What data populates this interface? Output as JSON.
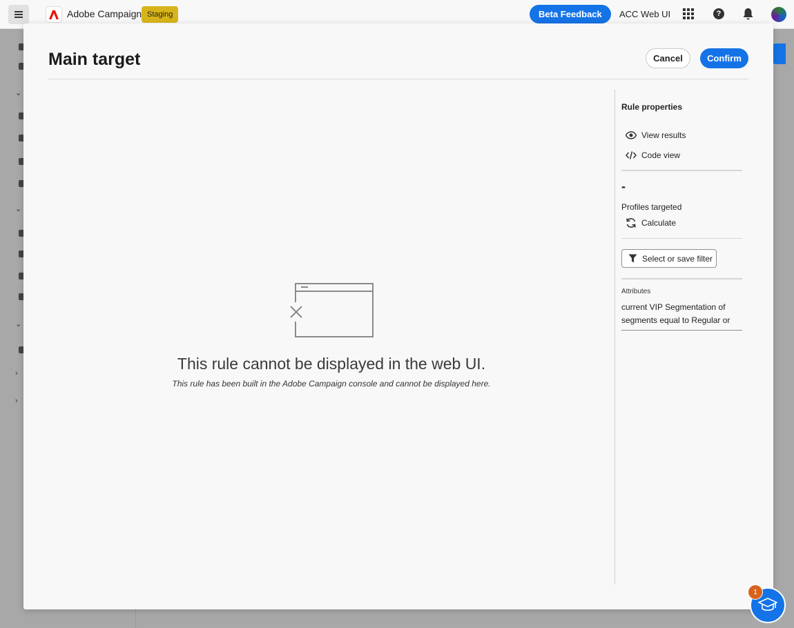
{
  "app": {
    "name": "Adobe Campaign",
    "environment": "Staging",
    "beta_feedback_label": "Beta Feedback",
    "org_name": "ACC Web UI"
  },
  "modal": {
    "title": "Main target",
    "cancel_label": "Cancel",
    "confirm_label": "Confirm",
    "empty_state": {
      "title": "This rule cannot be displayed in the web UI.",
      "description": "This rule has been built in the Adobe Campaign console and cannot be displayed here."
    },
    "side_panel": {
      "heading": "Rule properties",
      "view_results_label": "View results",
      "code_view_label": "Code view",
      "profiles_count": "-",
      "profiles_label": "Profiles targeted",
      "calculate_label": "Calculate",
      "filter_button_label": "Select or save filter",
      "attributes_label": "Attributes",
      "attributes_text": "current VIP Segmentation of segments equal to Regular or"
    }
  },
  "learn": {
    "badge_count": "1"
  },
  "colors": {
    "accent": "#1473e6",
    "env_badge": "#d8b41a",
    "notification": "#d8631c"
  }
}
